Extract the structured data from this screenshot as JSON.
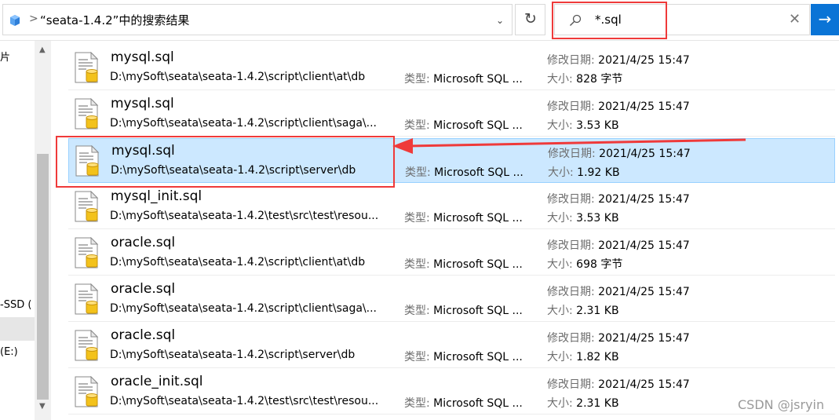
{
  "address": {
    "breadcrumb_sep": ">",
    "text": "“seata-1.4.2”中的搜索结果",
    "dropdown": "⌄"
  },
  "refresh_glyph": "↻",
  "search": {
    "value": "*.sql",
    "clear_glyph": "✕",
    "go_glyph": "→"
  },
  "nav": {
    "items": [
      "片",
      "-SSD (",
      "(E:)"
    ]
  },
  "files": [
    {
      "name": "mysql.sql",
      "path": "D:\\mySoft\\seata\\seata-1.4.2\\script\\client\\at\\db",
      "type_label": "类型:",
      "type_value": "Microsoft SQL ...",
      "date_label": "修改日期:",
      "date_value": "2021/4/25 15:47",
      "size_label": "大小:",
      "size_value": "828 字节"
    },
    {
      "name": "mysql.sql",
      "path": "D:\\mySoft\\seata\\seata-1.4.2\\script\\client\\saga\\...",
      "type_label": "类型:",
      "type_value": "Microsoft SQL ...",
      "date_label": "修改日期:",
      "date_value": "2021/4/25 15:47",
      "size_label": "大小:",
      "size_value": "3.53 KB"
    },
    {
      "name": "mysql.sql",
      "path": "D:\\mySoft\\seata\\seata-1.4.2\\script\\server\\db",
      "type_label": "类型:",
      "type_value": "Microsoft SQL ...",
      "date_label": "修改日期:",
      "date_value": "2021/4/25 15:47",
      "size_label": "大小:",
      "size_value": "1.92 KB"
    },
    {
      "name": "mysql_init.sql",
      "path": "D:\\mySoft\\seata\\seata-1.4.2\\test\\src\\test\\resou...",
      "type_label": "类型:",
      "type_value": "Microsoft SQL ...",
      "date_label": "修改日期:",
      "date_value": "2021/4/25 15:47",
      "size_label": "大小:",
      "size_value": "3.53 KB"
    },
    {
      "name": "oracle.sql",
      "path": "D:\\mySoft\\seata\\seata-1.4.2\\script\\client\\at\\db",
      "type_label": "类型:",
      "type_value": "Microsoft SQL ...",
      "date_label": "修改日期:",
      "date_value": "2021/4/25 15:47",
      "size_label": "大小:",
      "size_value": "698 字节"
    },
    {
      "name": "oracle.sql",
      "path": "D:\\mySoft\\seata\\seata-1.4.2\\script\\client\\saga\\...",
      "type_label": "类型:",
      "type_value": "Microsoft SQL ...",
      "date_label": "修改日期:",
      "date_value": "2021/4/25 15:47",
      "size_label": "大小:",
      "size_value": "2.31 KB"
    },
    {
      "name": "oracle.sql",
      "path": "D:\\mySoft\\seata\\seata-1.4.2\\script\\server\\db",
      "type_label": "类型:",
      "type_value": "Microsoft SQL ...",
      "date_label": "修改日期:",
      "date_value": "2021/4/25 15:47",
      "size_label": "大小:",
      "size_value": "1.82 KB"
    },
    {
      "name": "oracle_init.sql",
      "path": "D:\\mySoft\\seata\\seata-1.4.2\\test\\src\\test\\resou...",
      "type_label": "类型:",
      "type_value": "Microsoft SQL ...",
      "date_label": "修改日期:",
      "date_value": "2021/4/25 15:47",
      "size_label": "大小:",
      "size_value": "2.31 KB"
    }
  ],
  "selected_index": 2,
  "watermark": "CSDN @jsryin",
  "colors": {
    "selection_bg": "#cce8ff",
    "annotation_red": "#ef3a3a",
    "accent_blue": "#0a74d6"
  }
}
